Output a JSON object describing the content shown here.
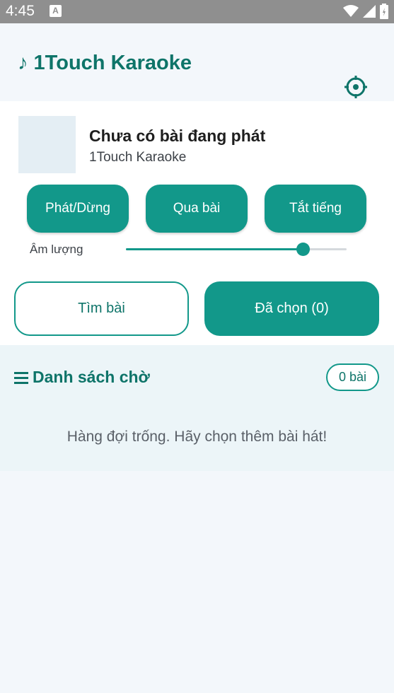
{
  "status_bar": {
    "time": "4:45",
    "notification_icon": "A"
  },
  "header": {
    "title": "♪ 1Touch Karaoke",
    "settings_icon": "gear-icon"
  },
  "now_playing": {
    "title": "Chưa có bài đang phát",
    "subtitle": "1Touch Karaoke"
  },
  "controls": {
    "play_pause": "Phát/Dừng",
    "skip": "Qua bài",
    "mute": "Tắt tiếng"
  },
  "volume": {
    "label": "Âm lượng",
    "level": 0.8
  },
  "actions": {
    "search": "Tìm bài",
    "selected": "Đã chọn (0)"
  },
  "queue": {
    "title": "Danh sách chờ",
    "count": "0 bài",
    "empty_message": "Hàng đợi trống. Hãy chọn thêm bài hát!"
  },
  "colors": {
    "accent": "#12988a",
    "accent_dark": "#0e7469"
  }
}
